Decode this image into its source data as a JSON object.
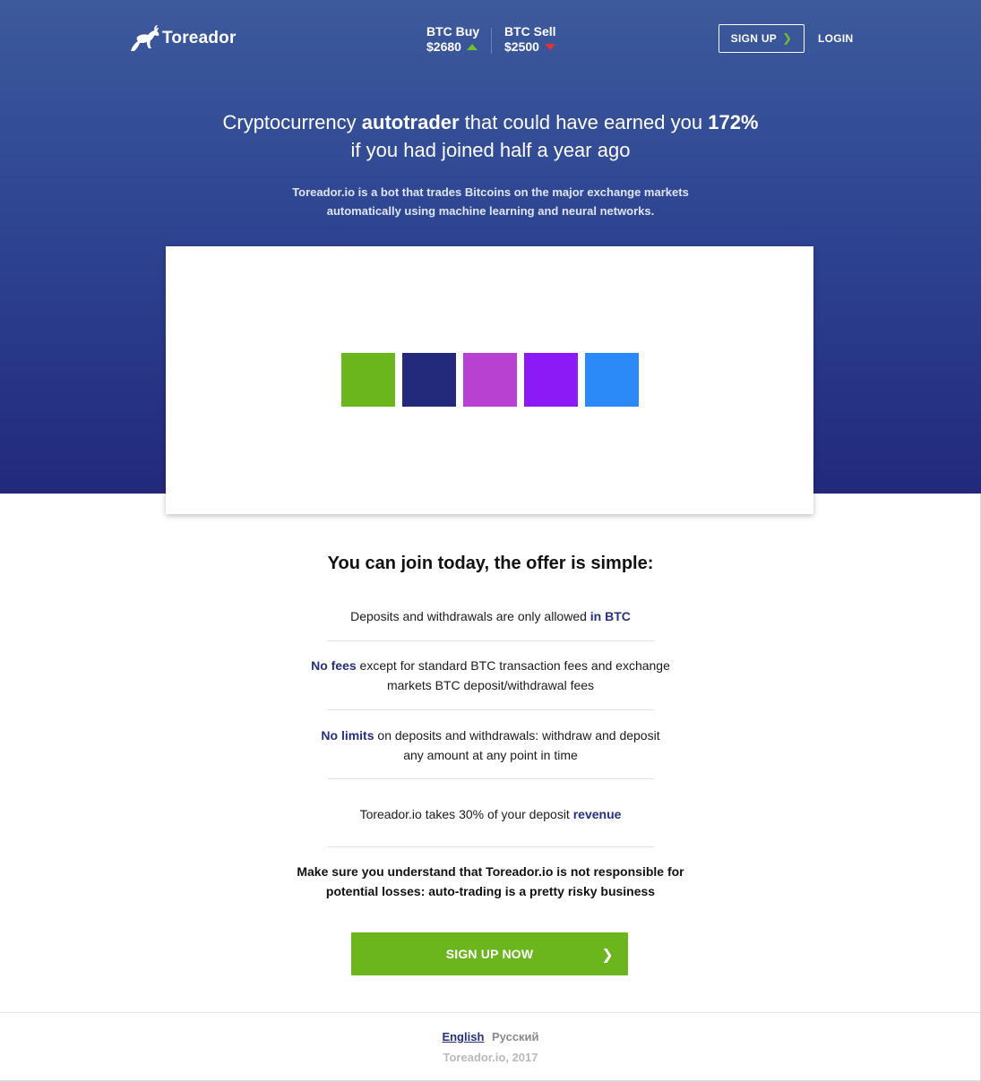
{
  "header": {
    "brand": "Toreador",
    "btc_buy_label": "BTC Buy",
    "btc_buy_value": "$2680",
    "btc_buy_trend": "up",
    "btc_sell_label": "BTC Sell",
    "btc_sell_value": "$2500",
    "btc_sell_trend": "down",
    "signup_label": "SIGN UP",
    "login_label": "LOGIN"
  },
  "hero": {
    "headline_part1": "Cryptocurrency ",
    "headline_bold1": "autotrader",
    "headline_part2": " that could have earned you ",
    "headline_bold2": "172%",
    "headline_line2": "if you had joined half a year ago",
    "subhead_line1": "Toreador.io is a bot that trades Bitcoins on the major exchange markets",
    "subhead_line2": "automatically using machine learning and neural networks."
  },
  "loader": {
    "swatch_colors": [
      "#6cb61d",
      "#232a7c",
      "#b941d1",
      "#8c1af7",
      "#2b8af8"
    ]
  },
  "offer": {
    "title": "You can join today, the offer is simple:",
    "item1_text": "Deposits and withdrawals are only allowed ",
    "item1_hl": "in BTC",
    "item2_hl": "No fees",
    "item2_text1": " except for standard BTC transaction fees and exchange",
    "item2_text2": "markets BTC deposit/withdrawal fees",
    "item3_hl": "No limits",
    "item3_text1": " on deposits and withdrawals: withdraw and deposit",
    "item3_text2": "any amount at any point in time",
    "item4_text": "Toreador.io takes 30% of your deposit ",
    "item4_hl": "revenue",
    "warning_line1": "Make sure you understand that Toreador.io is not responsible for",
    "warning_line2": "potential losses: auto-trading is a pretty risky business",
    "cta_label": "SIGN UP NOW"
  },
  "footer": {
    "lang_english": "English",
    "lang_russian": "Русский",
    "copyright": "Toreador.io, 2017"
  },
  "colors": {
    "brand_blue": "#26307e",
    "accent_green": "#6cb61d",
    "trend_up": "#6fc125",
    "trend_down": "#e0342c"
  },
  "icons": {
    "logo": "bull-icon",
    "up": "triangle-up-icon",
    "down": "triangle-down-icon",
    "chevron": "chevron-right-icon"
  }
}
